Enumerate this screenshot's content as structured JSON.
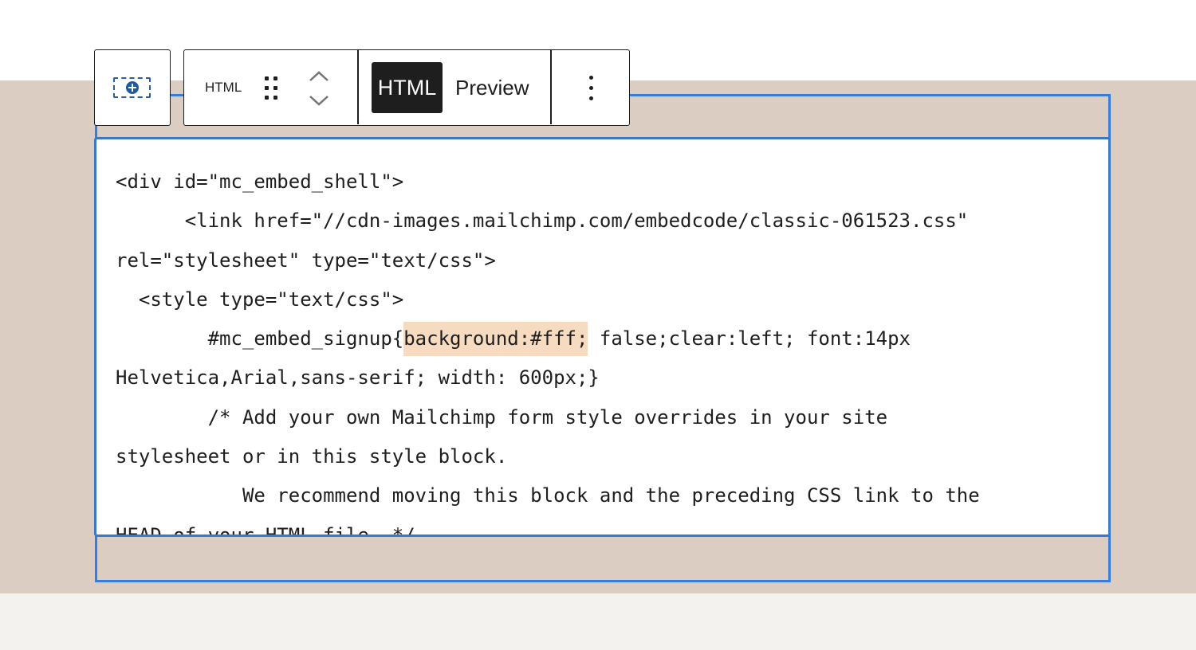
{
  "toolbar": {
    "inserter_icon": "add-block-icon",
    "block_type_label": "HTML",
    "drag_icon": "drag-handle-icon",
    "move_up_icon": "chevron-up-icon",
    "move_down_icon": "chevron-down-icon",
    "modes": [
      {
        "label": "HTML",
        "active": true
      },
      {
        "label": "Preview",
        "active": false
      }
    ],
    "options_icon": "more-vertical-icon"
  },
  "editor": {
    "lines": [
      "<div id=\"mc_embed_shell\">",
      "      <link href=\"//cdn-images.mailchimp.com/embedcode/classic-061523.css\"",
      "rel=\"stylesheet\" type=\"text/css\">",
      "  <style type=\"text/css\">",
      "        #mc_embed_signup{",
      "background:#fff;",
      " false;clear:left; font:14px",
      "Helvetica,Arial,sans-serif; width: 600px;}",
      "        /* Add your own Mailchimp form style overrides in your site",
      "stylesheet or in this style block.",
      "           We recommend moving this block and the preceding CSS link to the",
      "HEAD of your HTML file. */"
    ]
  },
  "colors": {
    "page_background": "#ffffff",
    "canvas_background": "#dccdc2",
    "footer_background": "#f3f2ee",
    "selection_outline": "#3a7be0",
    "highlight": "#f7dbc0",
    "active_mode": "#1e1e1e"
  }
}
